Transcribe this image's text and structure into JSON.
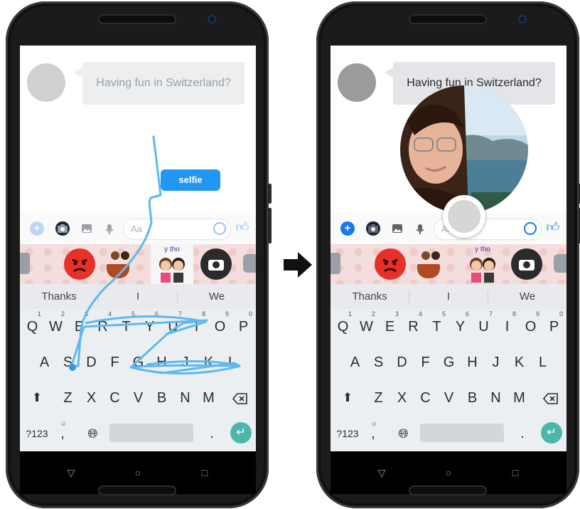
{
  "left_phone": {
    "message": "Having fun in Switzerland?",
    "composer_placeholder": "Aa",
    "sticker_caption": "y tho",
    "suggestions": [
      "Thanks",
      "I",
      "We"
    ],
    "swipe_word_chip": "selfie"
  },
  "right_phone": {
    "message": "Having fun in Switzerland?",
    "composer_placeholder": "Aa",
    "sticker_caption": "y tho",
    "suggestions": [
      "Thanks",
      "I",
      "We"
    ]
  },
  "keyboard": {
    "row1": [
      "Q",
      "W",
      "E",
      "R",
      "T",
      "Y",
      "U",
      "I",
      "O",
      "P"
    ],
    "row1_hints": [
      "1",
      "2",
      "3",
      "4",
      "5",
      "6",
      "7",
      "8",
      "9",
      "0"
    ],
    "row2": [
      "A",
      "S",
      "D",
      "F",
      "G",
      "H",
      "J",
      "K",
      "L"
    ],
    "row3": [
      "Z",
      "X",
      "C",
      "V",
      "B",
      "N",
      "M"
    ],
    "mode_key": "?123",
    "comma": ",",
    "period": "."
  },
  "icons": {
    "shift": "shift-icon",
    "backspace": "backspace-icon",
    "emoji": "emoji-hint-icon",
    "globe": "globe-icon",
    "enter": "enter-icon",
    "back": "nav-back-icon",
    "home": "nav-home-icon",
    "recents": "nav-recents-icon"
  },
  "colors": {
    "messenger_blue": "#1877f2",
    "swipe_trail": "#5fb8f0",
    "enter_key": "#4db6ac",
    "chip": "#2196f3"
  }
}
